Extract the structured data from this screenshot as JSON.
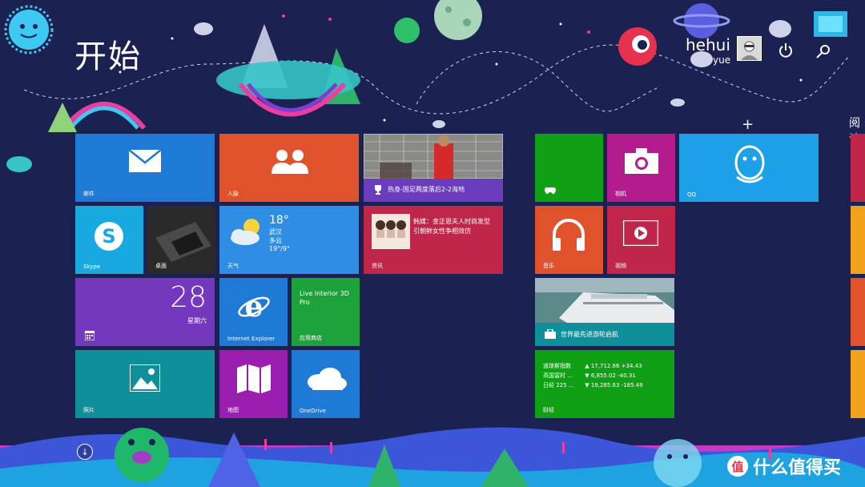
{
  "start": {
    "title": "开始"
  },
  "user": {
    "name": "hehui",
    "sub": "yue"
  },
  "tiles": {
    "mail": {
      "label": "邮件"
    },
    "people": {
      "label": "人脉"
    },
    "sports": {
      "caption": "热身-国足两度落后2-2海地"
    },
    "skype": {
      "label": "Skype"
    },
    "desktop": {
      "label": "桌面"
    },
    "weather": {
      "temp": "18°",
      "city": "武汉",
      "cond": "多云",
      "range": "19°/9°",
      "label": "天气"
    },
    "news": {
      "headline": "韩媒：金正恩夫人时尚发型引朝鲜女性争相效仿",
      "label": "资讯"
    },
    "calendar": {
      "day": "28",
      "weekday": "星期六"
    },
    "ie": {
      "label": "Internet Explorer"
    },
    "store": {
      "app": "Live Interior 3D Pro",
      "label": "应用商店"
    },
    "photos": {
      "label": "照片"
    },
    "maps": {
      "label": "地图"
    },
    "onedrive": {
      "label": "OneDrive"
    },
    "games": {
      "label": ""
    },
    "camera": {
      "label": "相机"
    },
    "qq": {
      "label": "QQ"
    },
    "music": {
      "label": "音乐"
    },
    "video": {
      "label": "视频"
    },
    "travel": {
      "caption": "世界最先进游轮启航"
    },
    "finance": {
      "label": "财经",
      "rows": [
        {
          "name": "道琼斯指数",
          "value": "▲ 17,712.66 +34.43"
        },
        {
          "name": "英国富时 …",
          "value": "▼ 6,855.02 -40.31"
        },
        {
          "name": "日经 225 …",
          "value": "▼ 19,285.63 -185.49"
        }
      ]
    }
  },
  "colors": {
    "bg": "#1b2150",
    "mail": "#1f7ad6",
    "people": "#e0522b",
    "skype": "#19a9e1",
    "weather": "#2f8ee3",
    "news": "#c0254a",
    "calendar": "#7438bf",
    "ie": "#1f7ad6",
    "store": "#1ca13b",
    "photos": "#0e8f9a",
    "maps": "#9a1fb0",
    "onedrive": "#1f7ad6",
    "games": "#10a015",
    "camera": "#b31c8c",
    "qq": "#1ea0e8",
    "music": "#e0522b",
    "video": "#c0254a",
    "travel": "#0e8f9a",
    "finance": "#10a015"
  },
  "watermark": {
    "text": "什么值得买"
  }
}
